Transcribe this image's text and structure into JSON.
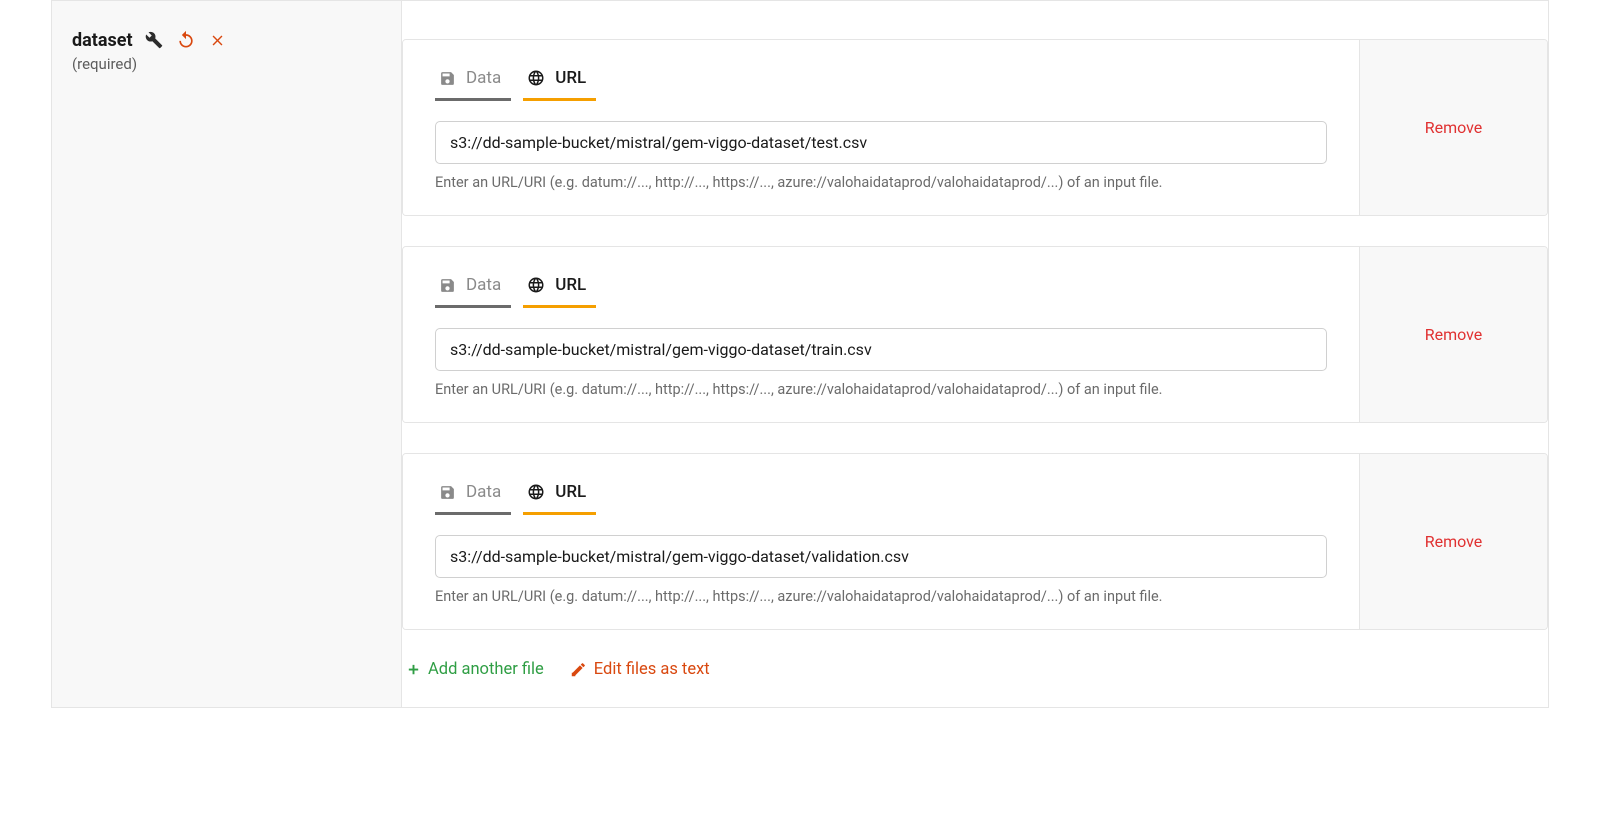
{
  "sidebar": {
    "title": "dataset",
    "required": "(required)"
  },
  "tabs": {
    "data_label": "Data",
    "url_label": "URL"
  },
  "helper_text": "Enter an URL/URI (e.g. datum://..., http://..., https://..., azure://valohaidataprod/valohaidataprod/...) of an input file.",
  "remove_label": "Remove",
  "files": [
    {
      "value": "s3://dd-sample-bucket/mistral/gem-viggo-dataset/test.csv"
    },
    {
      "value": "s3://dd-sample-bucket/mistral/gem-viggo-dataset/train.csv"
    },
    {
      "value": "s3://dd-sample-bucket/mistral/gem-viggo-dataset/validation.csv"
    }
  ],
  "actions": {
    "add": "Add another file",
    "edit": "Edit files as text"
  }
}
